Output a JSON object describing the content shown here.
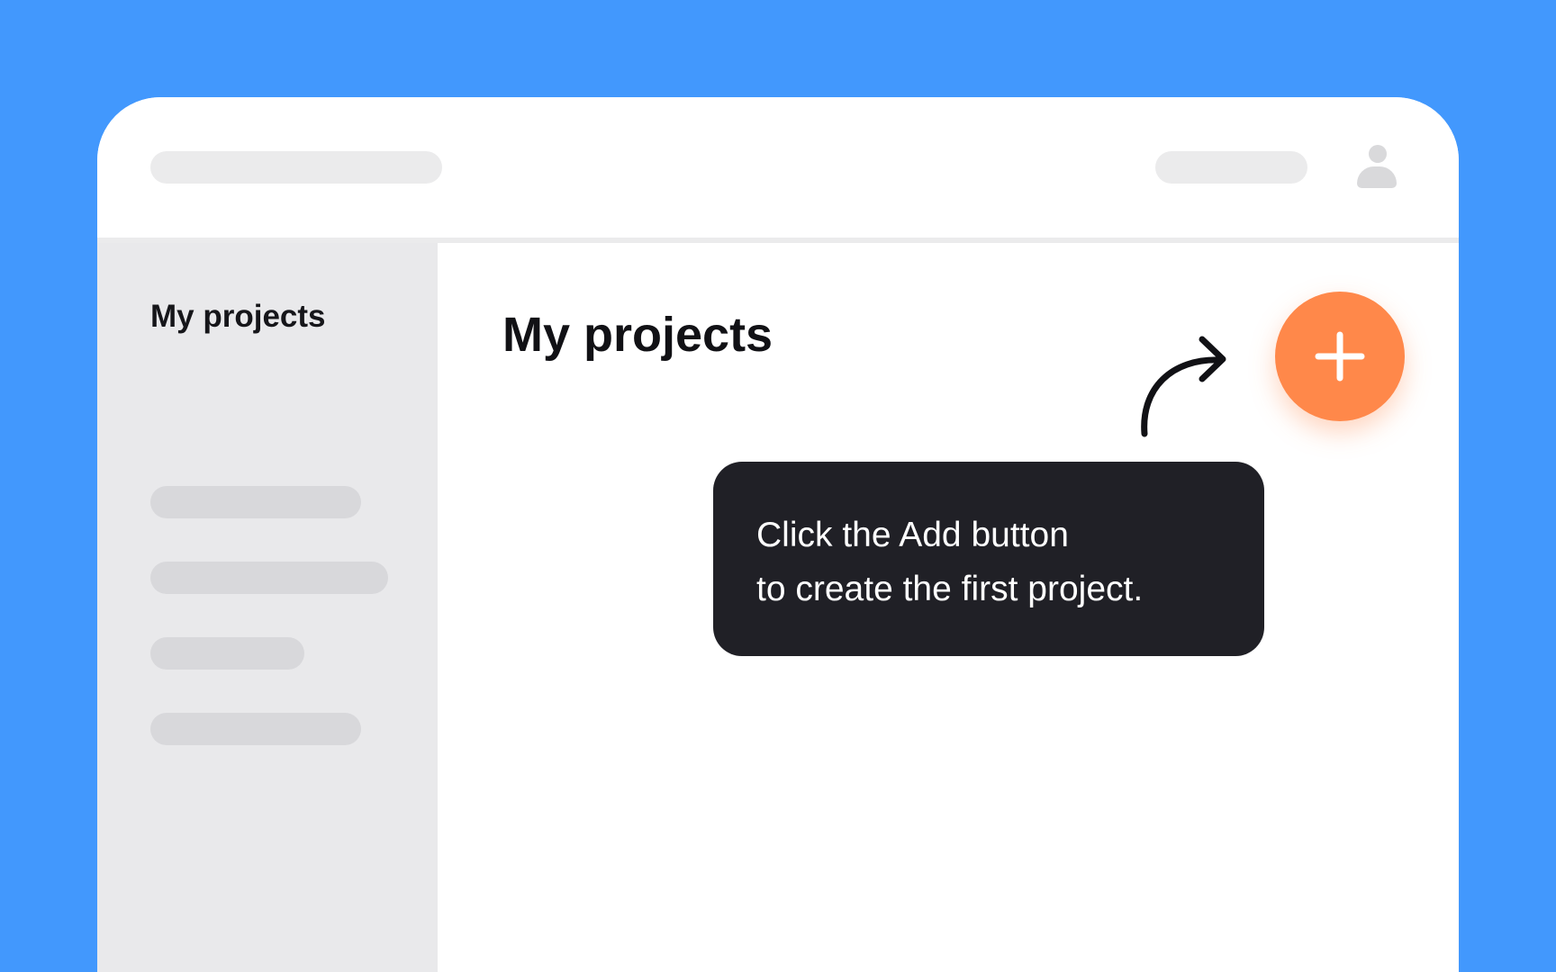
{
  "sidebar": {
    "title": "My projects"
  },
  "main": {
    "title": "My projects",
    "add_button_icon": "plus-icon"
  },
  "tooltip": {
    "line1": "Click the Add button",
    "line2": "to create the first project."
  },
  "topbar": {
    "avatar_icon": "user-icon"
  },
  "colors": {
    "background": "#4298FD",
    "accent": "#FF884A",
    "tooltip_bg": "#202026",
    "sidebar_bg": "#E9E9EB"
  }
}
